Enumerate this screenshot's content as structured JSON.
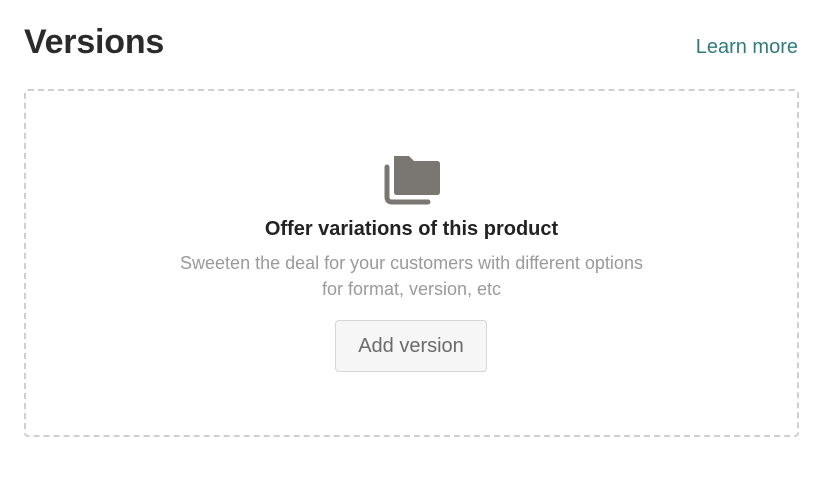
{
  "header": {
    "title": "Versions",
    "learn_more_label": "Learn more"
  },
  "empty_state": {
    "icon": "folders-icon",
    "title": "Offer variations of this product",
    "description_line1": "Sweeten the deal for your customers with different options",
    "description_line2": "for format, version, etc",
    "add_button_label": "Add version"
  },
  "colors": {
    "title_text": "#2b2b2b",
    "link": "#2f7a7e",
    "icon": "#7a7672",
    "description_text": "#9a9a9a",
    "dashed_border": "#cfcfcf",
    "button_bg": "#f6f6f6"
  }
}
